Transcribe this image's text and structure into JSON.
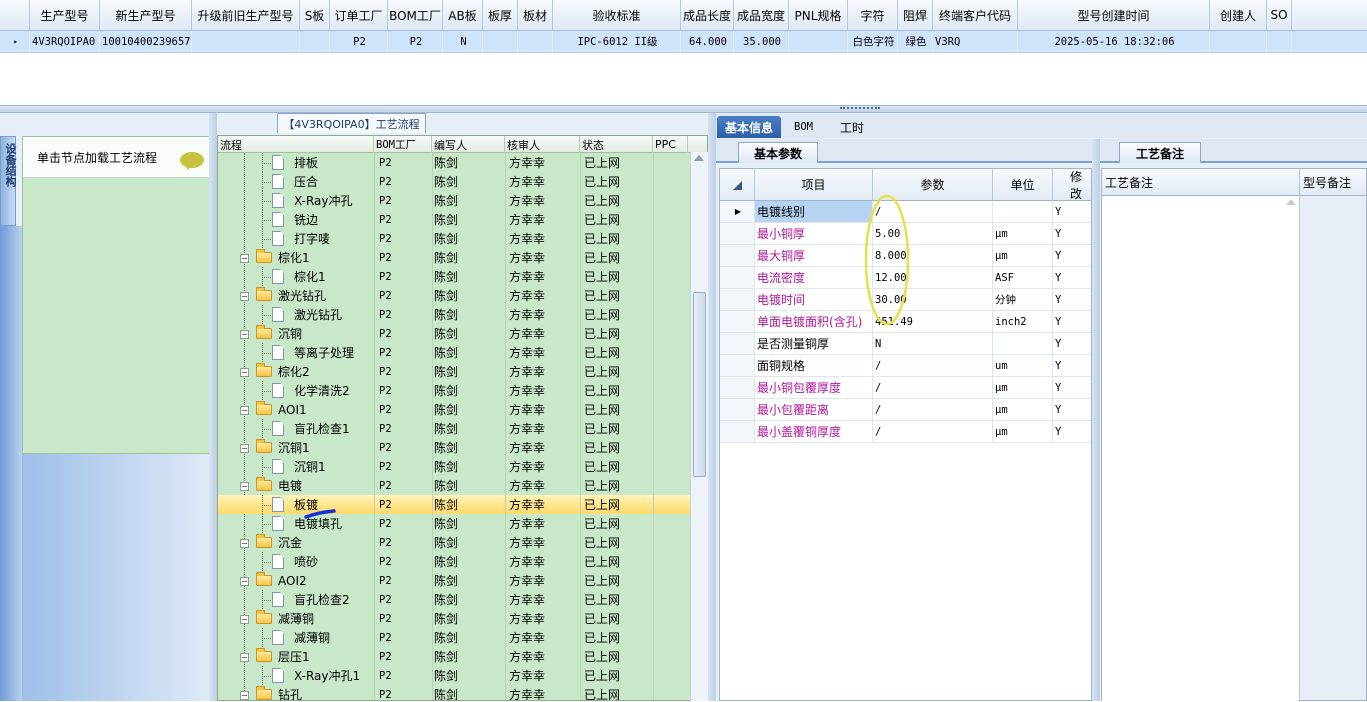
{
  "top_grid": {
    "columns": [
      "生产型号",
      "新生产型号",
      "升级前旧生产型号",
      "S板",
      "订单工厂",
      "BOM工厂",
      "AB板",
      "板厚",
      "板材",
      "验收标准",
      "成品长度",
      "成品宽度",
      "PNL规格",
      "字符",
      "阻焊",
      "终端客户代码",
      "型号创建时间",
      "创建人",
      "SO"
    ],
    "row": [
      "4V3RQOIPA0",
      "10010400239657",
      "",
      "",
      "P2",
      "P2",
      "N",
      "",
      "",
      "IPC-6012 II级",
      "64.000",
      "35.000",
      "",
      "白色字符",
      "绿色",
      "V3RQ",
      "2025-05-16 18:32:06",
      "",
      ""
    ]
  },
  "left_panel": {
    "vertical_tab": "设备结构",
    "node_hint": "单击节点加载工艺流程"
  },
  "tree": {
    "title": "【4V3RQOIPA0】工艺流程",
    "columns": [
      "流程",
      "BOM工厂",
      "编写人",
      "核审人",
      "状态",
      "PPC"
    ],
    "rows": [
      {
        "name": "排板",
        "level": 1,
        "folder": false,
        "bom": "P2",
        "writer": "陈剑",
        "reviewer": "方幸幸",
        "status": "已上网"
      },
      {
        "name": "压合",
        "level": 1,
        "folder": false,
        "bom": "P2",
        "writer": "陈剑",
        "reviewer": "方幸幸",
        "status": "已上网"
      },
      {
        "name": "X-Ray冲孔",
        "level": 1,
        "folder": false,
        "bom": "P2",
        "writer": "陈剑",
        "reviewer": "方幸幸",
        "status": "已上网"
      },
      {
        "name": "铣边",
        "level": 1,
        "folder": false,
        "bom": "P2",
        "writer": "陈剑",
        "reviewer": "方幸幸",
        "status": "已上网"
      },
      {
        "name": "打字唛",
        "level": 1,
        "folder": false,
        "bom": "P2",
        "writer": "陈剑",
        "reviewer": "方幸幸",
        "status": "已上网"
      },
      {
        "name": "棕化1",
        "level": 0,
        "folder": true,
        "bom": "P2",
        "writer": "陈剑",
        "reviewer": "方幸幸",
        "status": "已上网"
      },
      {
        "name": "棕化1",
        "level": 1,
        "folder": false,
        "bom": "P2",
        "writer": "陈剑",
        "reviewer": "方幸幸",
        "status": "已上网"
      },
      {
        "name": "激光钻孔",
        "level": 0,
        "folder": true,
        "bom": "P2",
        "writer": "陈剑",
        "reviewer": "方幸幸",
        "status": "已上网"
      },
      {
        "name": "激光钻孔",
        "level": 1,
        "folder": false,
        "bom": "P2",
        "writer": "陈剑",
        "reviewer": "方幸幸",
        "status": "已上网"
      },
      {
        "name": "沉铜",
        "level": 0,
        "folder": true,
        "bom": "P2",
        "writer": "陈剑",
        "reviewer": "方幸幸",
        "status": "已上网"
      },
      {
        "name": "等离子处理",
        "level": 1,
        "folder": false,
        "bom": "P2",
        "writer": "陈剑",
        "reviewer": "方幸幸",
        "status": "已上网"
      },
      {
        "name": "棕化2",
        "level": 0,
        "folder": true,
        "bom": "P2",
        "writer": "陈剑",
        "reviewer": "方幸幸",
        "status": "已上网"
      },
      {
        "name": "化学清洗2",
        "level": 1,
        "folder": false,
        "bom": "P2",
        "writer": "陈剑",
        "reviewer": "方幸幸",
        "status": "已上网"
      },
      {
        "name": "AOI1",
        "level": 0,
        "folder": true,
        "bom": "P2",
        "writer": "陈剑",
        "reviewer": "方幸幸",
        "status": "已上网"
      },
      {
        "name": "盲孔检查1",
        "level": 1,
        "folder": false,
        "bom": "P2",
        "writer": "陈剑",
        "reviewer": "方幸幸",
        "status": "已上网"
      },
      {
        "name": "沉铜1",
        "level": 0,
        "folder": true,
        "bom": "P2",
        "writer": "陈剑",
        "reviewer": "方幸幸",
        "status": "已上网"
      },
      {
        "name": "沉铜1",
        "level": 1,
        "folder": false,
        "bom": "P2",
        "writer": "陈剑",
        "reviewer": "方幸幸",
        "status": "已上网"
      },
      {
        "name": "电镀",
        "level": 0,
        "folder": true,
        "bom": "P2",
        "writer": "陈剑",
        "reviewer": "方幸幸",
        "status": "已上网"
      },
      {
        "name": "板镀",
        "level": 1,
        "folder": false,
        "bom": "P2",
        "writer": "陈剑",
        "reviewer": "方幸幸",
        "status": "已上网",
        "selected": true
      },
      {
        "name": "电镀填孔",
        "level": 1,
        "folder": false,
        "bom": "P2",
        "writer": "陈剑",
        "reviewer": "方幸幸",
        "status": "已上网"
      },
      {
        "name": "沉金",
        "level": 0,
        "folder": true,
        "bom": "P2",
        "writer": "陈剑",
        "reviewer": "方幸幸",
        "status": "已上网"
      },
      {
        "name": "喷砂",
        "level": 1,
        "folder": false,
        "bom": "P2",
        "writer": "陈剑",
        "reviewer": "方幸幸",
        "status": "已上网"
      },
      {
        "name": "AOI2",
        "level": 0,
        "folder": true,
        "bom": "P2",
        "writer": "陈剑",
        "reviewer": "方幸幸",
        "status": "已上网"
      },
      {
        "name": "盲孔检查2",
        "level": 1,
        "folder": false,
        "bom": "P2",
        "writer": "陈剑",
        "reviewer": "方幸幸",
        "status": "已上网"
      },
      {
        "name": "减薄铜",
        "level": 0,
        "folder": true,
        "bom": "P2",
        "writer": "陈剑",
        "reviewer": "方幸幸",
        "status": "已上网"
      },
      {
        "name": "减薄铜",
        "level": 1,
        "folder": false,
        "bom": "P2",
        "writer": "陈剑",
        "reviewer": "方幸幸",
        "status": "已上网"
      },
      {
        "name": "层压1",
        "level": 0,
        "folder": true,
        "bom": "P2",
        "writer": "陈剑",
        "reviewer": "方幸幸",
        "status": "已上网"
      },
      {
        "name": "X-Ray冲孔1",
        "level": 1,
        "folder": false,
        "bom": "P2",
        "writer": "陈剑",
        "reviewer": "方幸幸",
        "status": "已上网"
      },
      {
        "name": "钻孔",
        "level": 0,
        "folder": true,
        "bom": "P2",
        "writer": "陈剑",
        "reviewer": "方幸幸",
        "status": "已上网"
      }
    ]
  },
  "right": {
    "tabs": [
      "基本信息",
      "BOM",
      "工时"
    ],
    "subtab_params": "基本参数",
    "subtab_notes": "工艺备注",
    "param_columns": [
      "项目",
      "参数",
      "单位",
      "修改"
    ],
    "params": [
      {
        "item": "电镀线别",
        "value": "/",
        "unit": "",
        "mod": "Y",
        "highlight": false,
        "current": true
      },
      {
        "item": "最小铜厚",
        "value": "5.00",
        "unit": "μm",
        "mod": "Y",
        "highlight": true
      },
      {
        "item": "最大铜厚",
        "value": "8.000",
        "unit": "μm",
        "mod": "Y",
        "highlight": true
      },
      {
        "item": "电流密度",
        "value": "12.00",
        "unit": "ASF",
        "mod": "Y",
        "highlight": true
      },
      {
        "item": "电镀时间",
        "value": "30.00",
        "unit": "分钟",
        "mod": "Y",
        "highlight": true
      },
      {
        "item": "单面电镀面积(含孔)",
        "value": "451.49",
        "unit": "inch2",
        "mod": "Y",
        "highlight": true
      },
      {
        "item": "是否测量铜厚",
        "value": "N",
        "unit": "",
        "mod": "Y",
        "highlight": false
      },
      {
        "item": "面铜规格",
        "value": "/",
        "unit": "um",
        "mod": "Y",
        "highlight": false
      },
      {
        "item": "最小铜包覆厚度",
        "value": "/",
        "unit": "μm",
        "mod": "Y",
        "highlight": true
      },
      {
        "item": "最小包覆距离",
        "value": "/",
        "unit": "μm",
        "mod": "Y",
        "highlight": true
      },
      {
        "item": "最小盖覆铜厚度",
        "value": "/",
        "unit": "μm",
        "mod": "Y",
        "highlight": true
      }
    ],
    "notes_columns": [
      "工艺备注",
      "型号备注"
    ]
  },
  "colors": {
    "highlight_text": "#b0179a",
    "selection": "#ffd96a",
    "tree_bg": "#c9e7c9",
    "annotation": "#e8e04a",
    "pen": "#1530d8"
  }
}
